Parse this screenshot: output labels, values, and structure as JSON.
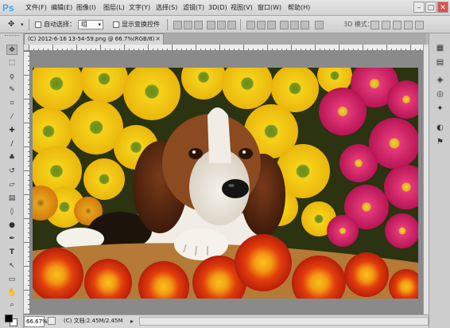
{
  "app": {
    "logo": "Ps"
  },
  "menu": {
    "items": [
      "文件(F)",
      "编辑(E)",
      "图像(I)",
      "图层(L)",
      "文字(Y)",
      "选择(S)",
      "滤镜(T)",
      "3D(D)",
      "视图(V)",
      "窗口(W)",
      "帮助(H)"
    ]
  },
  "window_controls": {
    "minimize": "–",
    "maximize": "□",
    "close": "✕"
  },
  "options": {
    "auto_select_label": "自动选择：",
    "auto_select_value": "组",
    "show_transform_label": "显示变换控件",
    "mode_3d_label": "3D 模式："
  },
  "document": {
    "tab_title": "(C) 2012-6-16 13-54-59.png @ 66.7%(RGB/8)",
    "close_glyph": "×"
  },
  "status": {
    "zoom": "66.67%",
    "doc_info": "(C) 文档:2.45M/2.45M"
  },
  "icons": {
    "move_tool": "move-icon",
    "marquee_tool": "marquee-icon",
    "lasso_tool": "lasso-icon",
    "quick_select_tool": "quick-select-icon",
    "crop_tool": "crop-icon",
    "eyedropper_tool": "eyedropper-icon",
    "healing_tool": "healing-icon",
    "brush_tool": "brush-icon",
    "stamp_tool": "stamp-icon",
    "history_brush_tool": "history-brush-icon",
    "eraser_tool": "eraser-icon",
    "gradient_tool": "gradient-icon",
    "blur_tool": "blur-icon",
    "dodge_tool": "dodge-icon",
    "pen_tool": "pen-icon",
    "type_tool": "type-icon",
    "path_select_tool": "path-select-icon",
    "shape_tool": "shape-icon",
    "hand_tool": "hand-icon",
    "zoom_tool": "zoom-icon",
    "foreground_color": "#000000",
    "background_color": "#ffffff"
  }
}
